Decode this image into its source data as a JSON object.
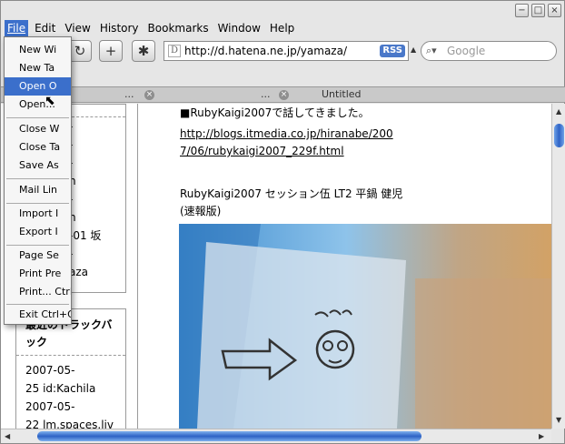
{
  "menubar": {
    "file": "File",
    "edit": "Edit",
    "view": "View",
    "history": "History",
    "bookmarks": "Bookmarks",
    "window": "Window",
    "help": "Help"
  },
  "window_controls": {
    "minimize": "−",
    "maximize": "□",
    "close": "×"
  },
  "toolbar": {
    "address": "http://d.hatena.ne.jp/yamaza/",
    "rss": "RSS",
    "search_placeholder": "Google"
  },
  "tabs": {
    "tab1_ellipsis": "...",
    "tab2_ellipsis": "...",
    "tab3_label": "Untitled"
  },
  "file_menu": {
    "items": [
      "New Wi",
      "New Ta",
      "Open O",
      "Open...",
      "Close W",
      "Close Ta",
      "Save As",
      "Mail Lin",
      "Import I",
      "Export I",
      "Page Se",
      "Print Pre",
      "Print...",
      "Exit"
    ],
    "shortcuts": {
      "print": "Ctrl+P",
      "exit": "Ctrl+Q"
    }
  },
  "sidebar": {
    "top_lines": [
      "-",
      "-",
      "-",
      "n",
      "-",
      "n",
      "-01 坂",
      "-",
      "aza"
    ],
    "trackback_title": "最近のトラックバック",
    "trackbacks": [
      "2007-05-",
      "25 id:Kachila",
      "2007-05-",
      "22 lm.spaces.liv"
    ]
  },
  "article": {
    "heading": "■RubyKaigi2007で話してきました。",
    "link1": "http://blogs.itmedia.co.jp/hiranabe/200",
    "link2": "7/06/rubykaigi2007_229f.html",
    "session_line": "RubyKaigi2007 セッション伍 LT2 平鍋 健児",
    "session_sub": "(速報版)"
  }
}
